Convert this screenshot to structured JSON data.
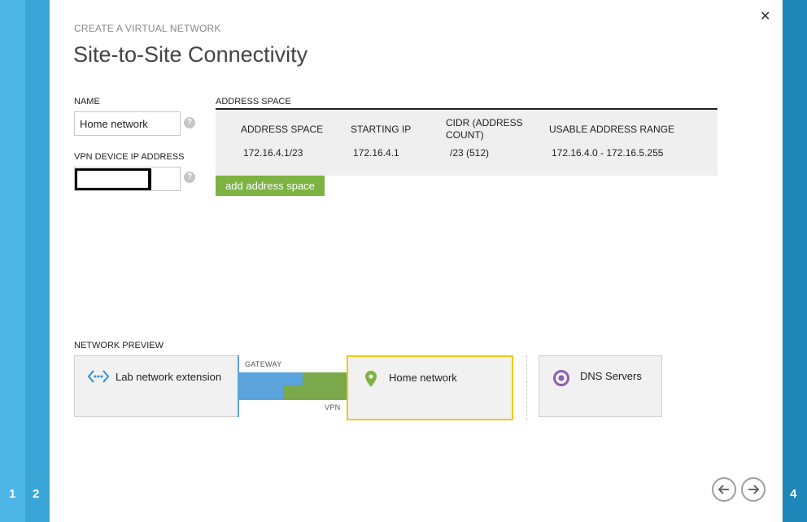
{
  "wizard": {
    "steps": [
      {
        "num": "1"
      },
      {
        "num": "2"
      },
      {
        "num": "4"
      }
    ],
    "eyebrow": "CREATE A VIRTUAL NETWORK",
    "title": "Site-to-Site Connectivity"
  },
  "form": {
    "name_label": "NAME",
    "name_value": "Home network",
    "vpn_label": "VPN DEVICE IP ADDRESS",
    "help_glyph": "?"
  },
  "address_space": {
    "section_label": "ADDRESS SPACE",
    "headers": [
      "ADDRESS SPACE",
      "STARTING IP",
      "CIDR (ADDRESS COUNT)",
      "USABLE ADDRESS RANGE"
    ],
    "row": [
      "172.16.4.1/23",
      "172.16.4.1",
      "/23 (512)",
      "172.16.4.0 - 172.16.5.255"
    ],
    "add_button": "add address space"
  },
  "preview": {
    "section_label": "NETWORK PREVIEW",
    "lab_network": "Lab network extension",
    "gateway_label": "GATEWAY",
    "vpn_label": "VPN",
    "home_network": "Home network",
    "dns_servers": "DNS Servers"
  },
  "colors": {
    "accent_green": "#7cb342",
    "step_blue": "#1f86b9",
    "highlight_yellow": "#f2c811",
    "dns_purple": "#8c5fb0"
  }
}
